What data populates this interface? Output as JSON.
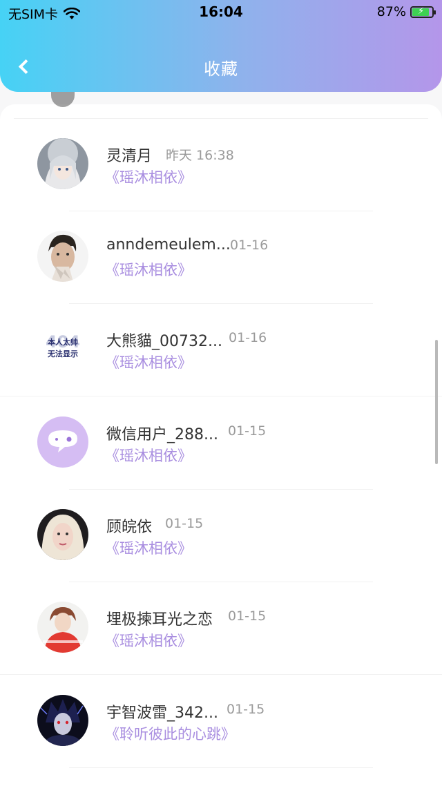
{
  "status_bar": {
    "carrier": "无SIM卡",
    "time": "16:04",
    "battery_percent": "87%",
    "battery_level": 0.87,
    "wifi_icon": "wifi-icon"
  },
  "header": {
    "title": "收藏",
    "back_icon": "chevron-left-icon",
    "gradient_colors": [
      "#46d2f5",
      "#8fb2ec",
      "#b496ea"
    ]
  },
  "colors": {
    "work_title": "#a98ee0",
    "name": "#333333",
    "date": "#9a9a9a"
  },
  "items": [
    {
      "name": "灵清月",
      "date": "昨天 16:38",
      "work": "《瑶沐相依》",
      "avatar": "anime-girl-avatar"
    },
    {
      "name": "anndemeulem...",
      "date": "01-16",
      "work": "《瑶沐相依》",
      "avatar": "man-photo-avatar"
    },
    {
      "name": "大熊貓_00732...",
      "date": "01-16",
      "work": "《瑶沐相依》",
      "avatar": "placeholder-text-avatar",
      "avatar_text_1": "本人太帅",
      "avatar_text_2": "无法显示"
    },
    {
      "name": "微信用户_288...",
      "date": "01-15",
      "work": "《瑶沐相依》",
      "avatar": "chat-bubble-avatar"
    },
    {
      "name": "顾皖依",
      "date": "01-15",
      "work": "《瑶沐相依》",
      "avatar": "girl-photo-avatar"
    },
    {
      "name": "埋极揀耳光之恋",
      "date": "01-15",
      "work": "《瑶沐相依》",
      "avatar": "red-shirt-avatar"
    },
    {
      "name": "宇智波雷_342...",
      "date": "01-15",
      "work": "《聆听彼此的心跳》",
      "avatar": "dark-anime-avatar"
    }
  ]
}
